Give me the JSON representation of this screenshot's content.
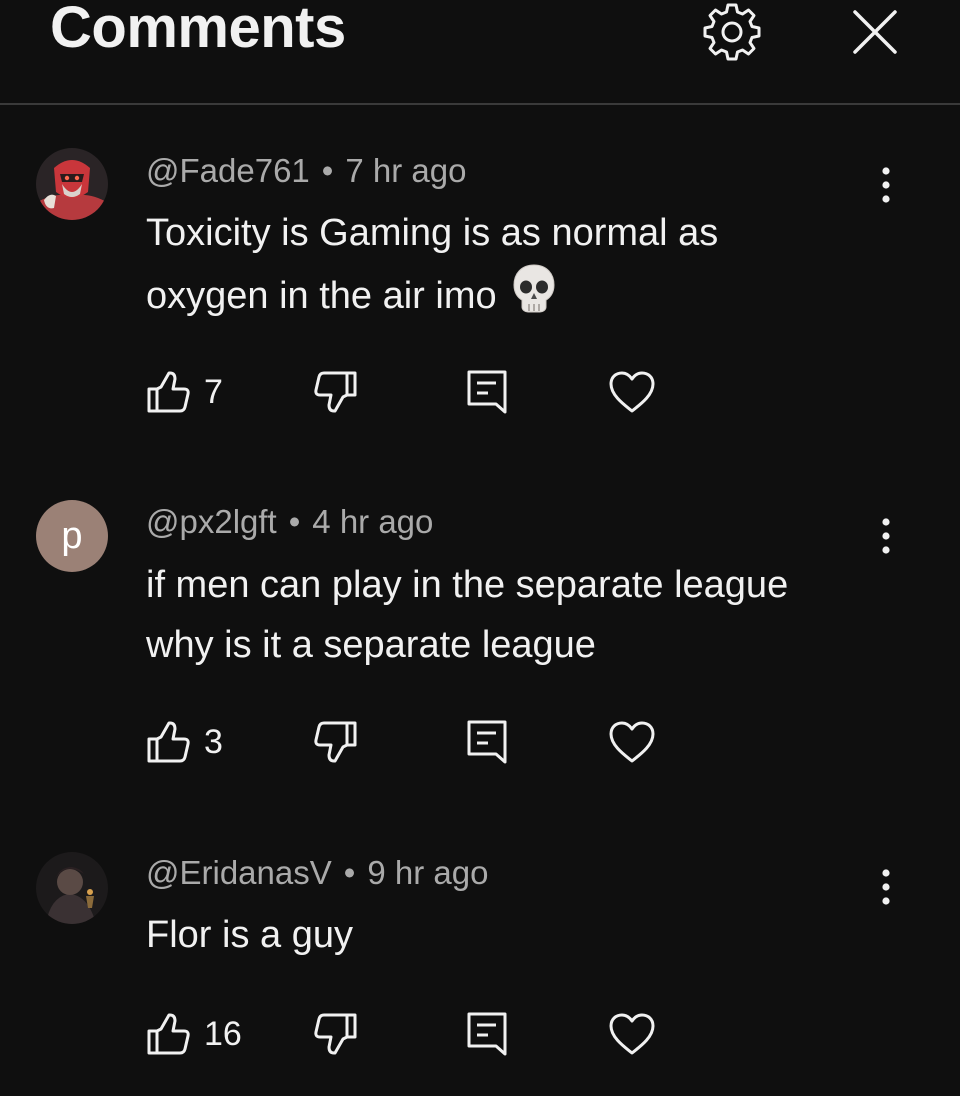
{
  "header": {
    "title": "Comments",
    "settings_icon": "gear-icon",
    "close_icon": "close-icon"
  },
  "colors": {
    "background": "#0f0f0f",
    "text": "#f1f1f1",
    "meta": "#aaaaaa",
    "divider": "#3a3a3a",
    "avatar_letter_bg": "#9b8176"
  },
  "comments": [
    {
      "author": "@Fade761",
      "separator": "•",
      "time": "7 hr ago",
      "text": "Toxicity is Gaming is as normal as oxygen in the air imo",
      "emoji": "skull-emoji",
      "likes": "7"
    },
    {
      "author": "@px2lgft",
      "separator": "•",
      "time": "4 hr ago",
      "avatar_letter": "p",
      "text": "if men can play in the separate league why is it a separate league",
      "likes": "3"
    },
    {
      "author": "@EridanasV",
      "separator": "•",
      "time": "9 hr ago",
      "text": "Flor is a guy",
      "likes": "16"
    }
  ]
}
